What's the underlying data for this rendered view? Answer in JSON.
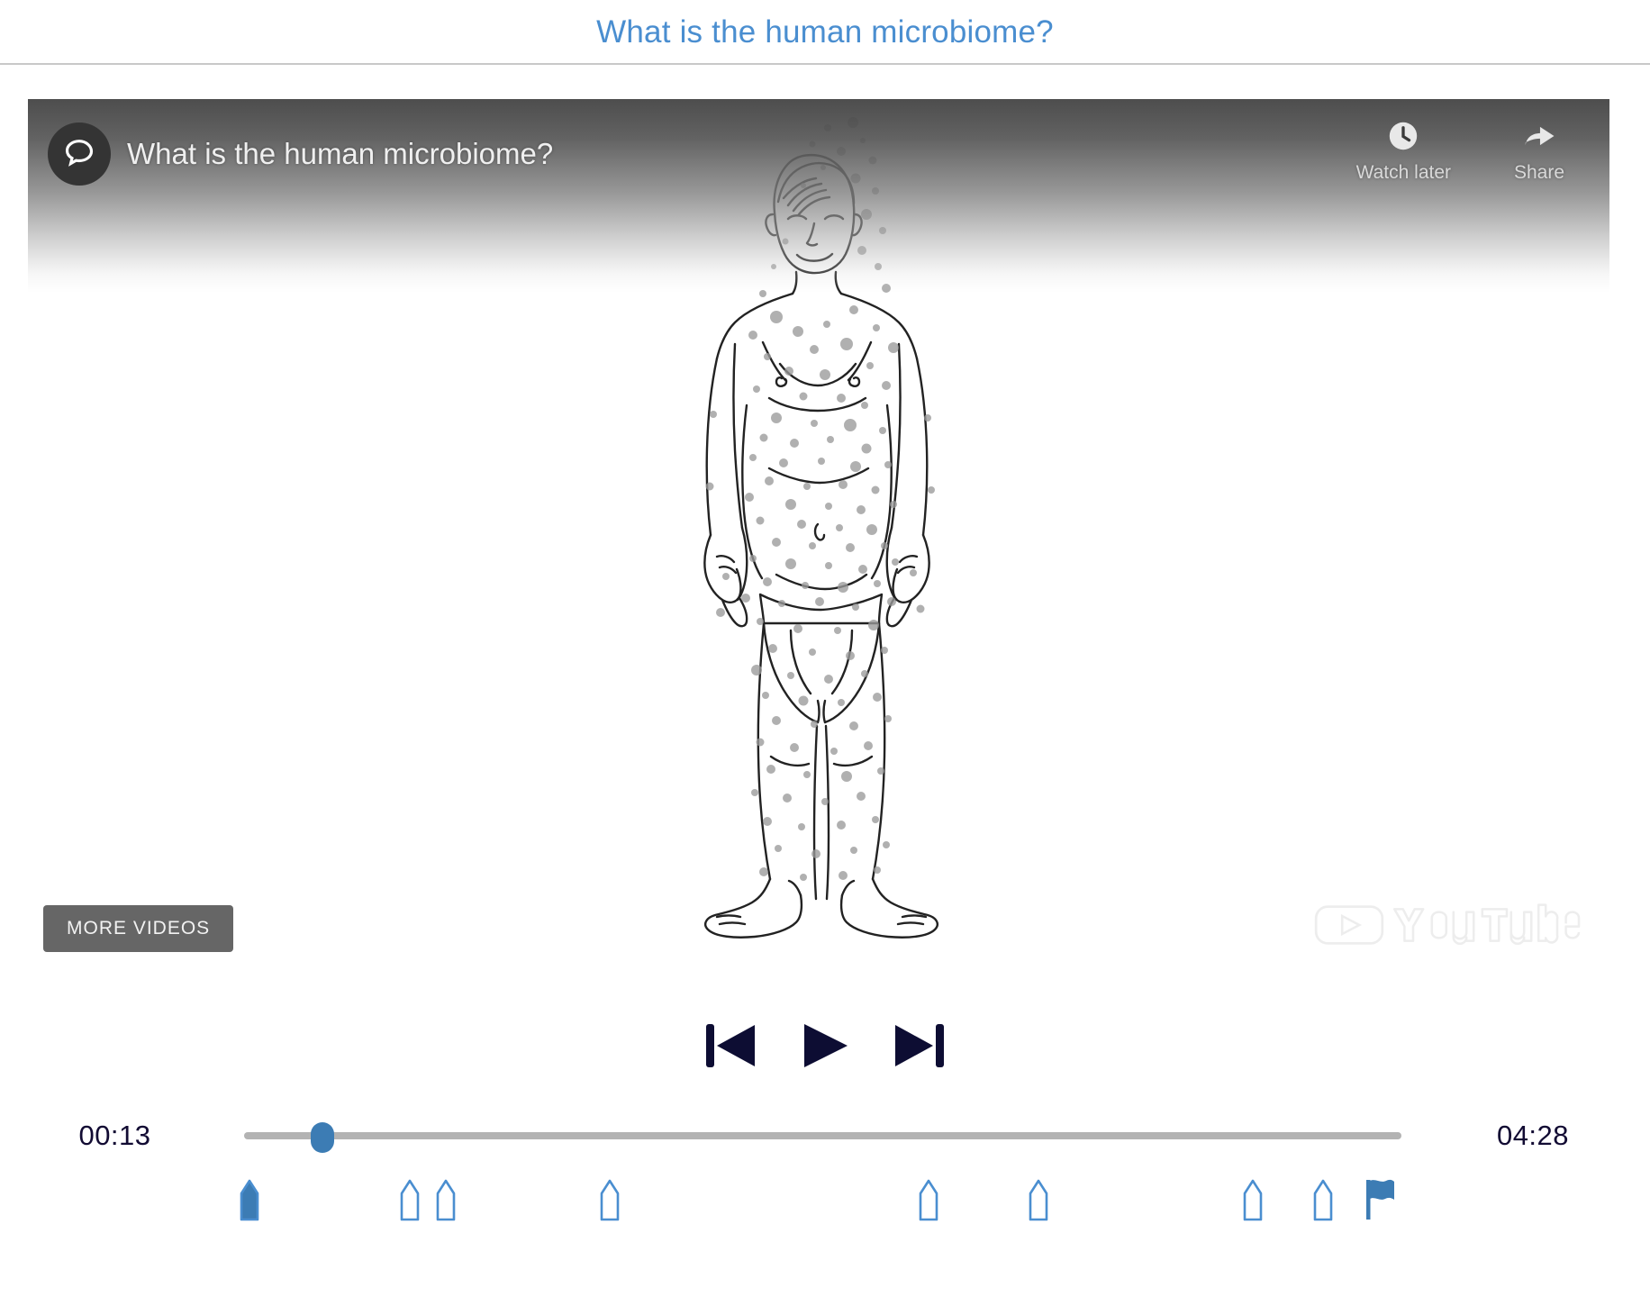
{
  "page": {
    "title": "What is the human microbiome?",
    "title_color": "#4a8ed0"
  },
  "player": {
    "video_title": "What is the human microbiome?",
    "channel_avatar_icon": "speech-bubble-icon",
    "actions": [
      {
        "label": "Watch later",
        "icon": "clock-icon"
      },
      {
        "label": "Share",
        "icon": "share-arrow-icon"
      }
    ],
    "more_videos_label": "MORE VIDEOS",
    "brand": "YouTube",
    "brand_icon": "youtube-play-icon",
    "poster_alt": "Line drawing of a standing man covered in microbe dots"
  },
  "transport": {
    "previous_label": "Previous",
    "play_label": "Play",
    "next_label": "Next",
    "control_color": "#0d0d33"
  },
  "seek": {
    "current_time": "00:13",
    "total_time": "04:28",
    "progress_percent": 6.8,
    "track_color": "#b3b3b3",
    "thumb_color": "#3c7cb4",
    "time_color": "#120b33"
  },
  "markers": {
    "accent_color": "#4a8ed0",
    "active_color": "#3c7cb4",
    "items": [
      {
        "name": "chapter-marker-1",
        "position_percent": 0.5,
        "state": "active"
      },
      {
        "name": "chapter-marker-2",
        "position_percent": 14.3,
        "state": "inactive"
      },
      {
        "name": "chapter-marker-3",
        "position_percent": 17.4,
        "state": "inactive"
      },
      {
        "name": "chapter-marker-4",
        "position_percent": 31.5,
        "state": "inactive"
      },
      {
        "name": "chapter-marker-5",
        "position_percent": 58.9,
        "state": "inactive"
      },
      {
        "name": "chapter-marker-6",
        "position_percent": 68.4,
        "state": "inactive"
      },
      {
        "name": "chapter-marker-7",
        "position_percent": 86.8,
        "state": "inactive"
      },
      {
        "name": "chapter-marker-8",
        "position_percent": 92.9,
        "state": "inactive"
      },
      {
        "name": "end-flag-marker",
        "position_percent": 97.8,
        "state": "flag"
      }
    ]
  }
}
